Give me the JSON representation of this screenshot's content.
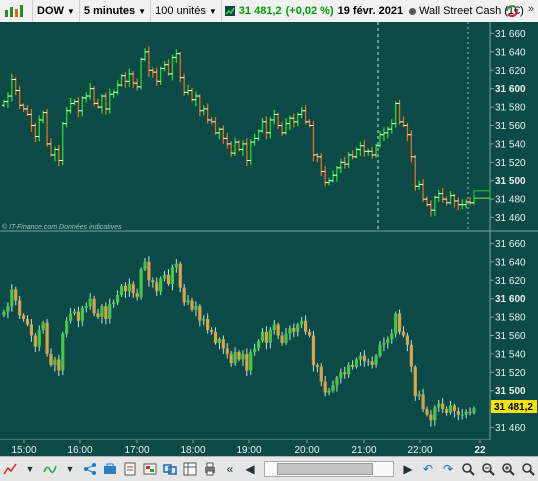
{
  "toolbar": {
    "symbol": "DOW",
    "timeframe": "5 minutes",
    "units": "100 unités",
    "price": "31 481,2",
    "change": "(+0,02 %)",
    "date": "19 févr. 2021",
    "instrument": "Wall Street Cash (1€)"
  },
  "watermark": "© IT-Finance.com  Données indicatives",
  "top_axis_labels": [
    "31 660",
    "31 640",
    "31 620",
    "31 600",
    "31 580",
    "31 560",
    "31 540",
    "31 520",
    "31 500",
    "31 480",
    "31 460"
  ],
  "bottom_axis_labels": [
    "31 660",
    "31 640",
    "31 620",
    "31 600",
    "31 580",
    "31 560",
    "31 540",
    "31 520",
    "31 500",
    "31 480",
    "31 460"
  ],
  "last_price_label": "31 481,2",
  "time_labels": [
    "15:00",
    "16:00",
    "17:00",
    "18:00",
    "19:00",
    "20:00",
    "21:00",
    "22:00",
    "22"
  ],
  "icons": [
    "chart-type-icon",
    "indicator-icon",
    "share-icon",
    "toolbox-icon",
    "notes-icon",
    "alerts-icon",
    "link-icon",
    "table-icon",
    "print-icon",
    "scroll-left-icon",
    "scroll-right-icon",
    "undo-icon",
    "redo-icon",
    "zoom-fit-icon",
    "zoom-out-icon",
    "zoom-in-icon",
    "zoom-reset-icon"
  ],
  "colors": {
    "background": "#0b4a46",
    "up": "#22dd22",
    "down": "#e2701a",
    "wick": "#ffffff"
  },
  "chart_data": [
    {
      "type": "ohlc",
      "pane": "top",
      "ylim": [
        31453,
        31667
      ],
      "x_ticks": [
        "15:00",
        "16:00",
        "17:00",
        "18:00",
        "19:00",
        "20:00",
        "21:00",
        "22:00"
      ],
      "close": [
        31586,
        31592,
        31610,
        31598,
        31582,
        31578,
        31572,
        31560,
        31548,
        31566,
        31574,
        31540,
        31528,
        31534,
        31522,
        31562,
        31576,
        31584,
        31586,
        31576,
        31590,
        31592,
        31600,
        31584,
        31580,
        31592,
        31578,
        31594,
        31596,
        31604,
        31614,
        31608,
        31616,
        31606,
        31602,
        31632,
        31640,
        31620,
        31618,
        31608,
        31622,
        31626,
        31616,
        31634,
        31638,
        31612,
        31596,
        31598,
        31588,
        31592,
        31576,
        31578,
        31566,
        31564,
        31552,
        31556,
        31546,
        31540,
        31530,
        31542,
        31534,
        31540,
        31522,
        31542,
        31546,
        31554,
        31564,
        31552,
        31566,
        31572,
        31560,
        31552,
        31562,
        31568,
        31564,
        31572,
        31576,
        31564,
        31560,
        31528,
        31526,
        31510,
        31498,
        31500,
        31506,
        31514,
        31520,
        31518,
        31528,
        31526,
        31534,
        31538,
        31532,
        31532,
        31528,
        31538,
        31550,
        31552,
        31556,
        31562,
        31584,
        31564,
        31560,
        31550,
        31526,
        31494,
        31496,
        31480,
        31474,
        31468,
        31482,
        31486,
        31480,
        31476,
        31484,
        31478,
        31474,
        31474,
        31477,
        31476,
        31481
      ]
    },
    {
      "type": "candlestick",
      "pane": "bottom",
      "ylim": [
        31453,
        31667
      ],
      "x_ticks": [
        "15:00",
        "16:00",
        "17:00",
        "18:00",
        "19:00",
        "20:00",
        "21:00",
        "22:00"
      ],
      "close": [
        31586,
        31592,
        31610,
        31598,
        31582,
        31578,
        31572,
        31560,
        31548,
        31566,
        31574,
        31540,
        31528,
        31534,
        31522,
        31562,
        31576,
        31584,
        31586,
        31576,
        31590,
        31592,
        31600,
        31584,
        31580,
        31592,
        31578,
        31594,
        31596,
        31604,
        31614,
        31608,
        31616,
        31606,
        31602,
        31632,
        31640,
        31620,
        31618,
        31608,
        31622,
        31626,
        31616,
        31634,
        31638,
        31612,
        31596,
        31598,
        31588,
        31592,
        31576,
        31578,
        31566,
        31564,
        31552,
        31556,
        31546,
        31540,
        31530,
        31542,
        31534,
        31540,
        31522,
        31542,
        31546,
        31554,
        31564,
        31552,
        31566,
        31572,
        31560,
        31552,
        31562,
        31568,
        31564,
        31572,
        31576,
        31564,
        31560,
        31528,
        31526,
        31510,
        31498,
        31500,
        31506,
        31514,
        31520,
        31518,
        31528,
        31526,
        31534,
        31538,
        31532,
        31532,
        31528,
        31538,
        31550,
        31552,
        31556,
        31562,
        31584,
        31564,
        31560,
        31550,
        31526,
        31494,
        31496,
        31480,
        31474,
        31468,
        31482,
        31486,
        31480,
        31476,
        31484,
        31478,
        31474,
        31474,
        31477,
        31476,
        31481
      ]
    }
  ]
}
